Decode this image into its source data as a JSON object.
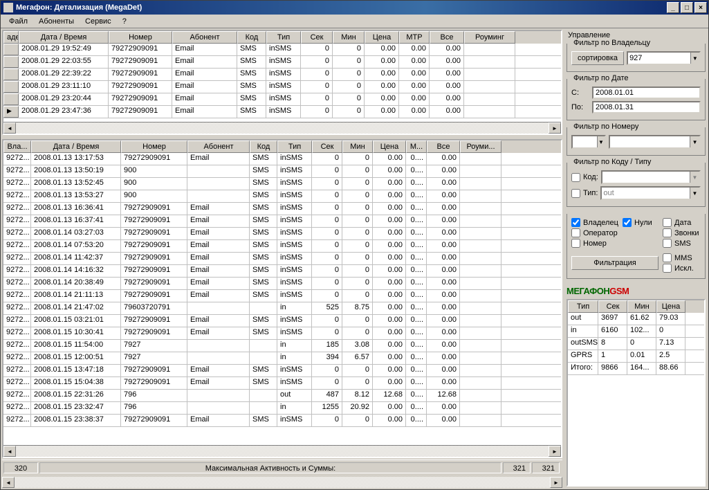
{
  "window": {
    "title": "Мегафон: Детализация (MegaDet)"
  },
  "menu": [
    "Файл",
    "Абоненты",
    "Сервис",
    "?"
  ],
  "grid1": {
    "headers": [
      "аде…",
      "Дата / Время",
      "Номер",
      "Абонент",
      "Код",
      "Тип",
      "Сек",
      "Мин",
      "Цена",
      "МТР",
      "Все",
      "Роуминг"
    ],
    "rows": [
      {
        "mark": "",
        "dt": "2008.01.29 19:52:49",
        "num": "79272909091",
        "ab": "Email",
        "kod": "SMS",
        "tip": "inSMS",
        "sek": "0",
        "min": "0",
        "price": "0.00",
        "mtr": "0.00",
        "all": "0.00",
        "roam": ""
      },
      {
        "mark": "",
        "dt": "2008.01.29 22:03:55",
        "num": "79272909091",
        "ab": "Email",
        "kod": "SMS",
        "tip": "inSMS",
        "sek": "0",
        "min": "0",
        "price": "0.00",
        "mtr": "0.00",
        "all": "0.00",
        "roam": ""
      },
      {
        "mark": "",
        "dt": "2008.01.29 22:39:22",
        "num": "79272909091",
        "ab": "Email",
        "kod": "SMS",
        "tip": "inSMS",
        "sek": "0",
        "min": "0",
        "price": "0.00",
        "mtr": "0.00",
        "all": "0.00",
        "roam": ""
      },
      {
        "mark": "",
        "dt": "2008.01.29 23:11:10",
        "num": "79272909091",
        "ab": "Email",
        "kod": "SMS",
        "tip": "inSMS",
        "sek": "0",
        "min": "0",
        "price": "0.00",
        "mtr": "0.00",
        "all": "0.00",
        "roam": ""
      },
      {
        "mark": "",
        "dt": "2008.01.29 23:20:44",
        "num": "79272909091",
        "ab": "Email",
        "kod": "SMS",
        "tip": "inSMS",
        "sek": "0",
        "min": "0",
        "price": "0.00",
        "mtr": "0.00",
        "all": "0.00",
        "roam": ""
      },
      {
        "mark": "cur",
        "dt": "2008.01.29 23:47:36",
        "num": "79272909091",
        "ab": "Email",
        "kod": "SMS",
        "tip": "inSMS",
        "sek": "0",
        "min": "0",
        "price": "0.00",
        "mtr": "0.00",
        "all": "0.00",
        "roam": ""
      }
    ]
  },
  "grid2": {
    "headers": [
      "Вла...",
      "Дата / Время",
      "Номер",
      "Абонент",
      "Код",
      "Тип",
      "Сек",
      "Мин",
      "Цена",
      "М...",
      "Все",
      "Роуми..."
    ],
    "rows": [
      {
        "own": "9272...",
        "dt": "2008.01.13 13:17:53",
        "num": "79272909091",
        "ab": "Email",
        "kod": "SMS",
        "tip": "inSMS",
        "sek": "0",
        "min": "0",
        "price": "0.00",
        "mtr": "0....",
        "all": "0.00",
        "roam": ""
      },
      {
        "own": "9272...",
        "dt": "2008.01.13 13:50:19",
        "num": "900",
        "ab": "",
        "kod": "SMS",
        "tip": "inSMS",
        "sek": "0",
        "min": "0",
        "price": "0.00",
        "mtr": "0....",
        "all": "0.00",
        "roam": ""
      },
      {
        "own": "9272...",
        "dt": "2008.01.13 13:52:45",
        "num": "900",
        "ab": "",
        "kod": "SMS",
        "tip": "inSMS",
        "sek": "0",
        "min": "0",
        "price": "0.00",
        "mtr": "0....",
        "all": "0.00",
        "roam": ""
      },
      {
        "own": "9272...",
        "dt": "2008.01.13 13:53:27",
        "num": "900",
        "ab": "",
        "kod": "SMS",
        "tip": "inSMS",
        "sek": "0",
        "min": "0",
        "price": "0.00",
        "mtr": "0....",
        "all": "0.00",
        "roam": ""
      },
      {
        "own": "9272...",
        "dt": "2008.01.13 16:36:41",
        "num": "79272909091",
        "ab": "Email",
        "kod": "SMS",
        "tip": "inSMS",
        "sek": "0",
        "min": "0",
        "price": "0.00",
        "mtr": "0....",
        "all": "0.00",
        "roam": ""
      },
      {
        "own": "9272...",
        "dt": "2008.01.13 16:37:41",
        "num": "79272909091",
        "ab": "Email",
        "kod": "SMS",
        "tip": "inSMS",
        "sek": "0",
        "min": "0",
        "price": "0.00",
        "mtr": "0....",
        "all": "0.00",
        "roam": ""
      },
      {
        "own": "9272...",
        "dt": "2008.01.14 03:27:03",
        "num": "79272909091",
        "ab": "Email",
        "kod": "SMS",
        "tip": "inSMS",
        "sek": "0",
        "min": "0",
        "price": "0.00",
        "mtr": "0....",
        "all": "0.00",
        "roam": ""
      },
      {
        "own": "9272...",
        "dt": "2008.01.14 07:53:20",
        "num": "79272909091",
        "ab": "Email",
        "kod": "SMS",
        "tip": "inSMS",
        "sek": "0",
        "min": "0",
        "price": "0.00",
        "mtr": "0....",
        "all": "0.00",
        "roam": ""
      },
      {
        "own": "9272...",
        "dt": "2008.01.14 11:42:37",
        "num": "79272909091",
        "ab": "Email",
        "kod": "SMS",
        "tip": "inSMS",
        "sek": "0",
        "min": "0",
        "price": "0.00",
        "mtr": "0....",
        "all": "0.00",
        "roam": ""
      },
      {
        "own": "9272...",
        "dt": "2008.01.14 14:16:32",
        "num": "79272909091",
        "ab": "Email",
        "kod": "SMS",
        "tip": "inSMS",
        "sek": "0",
        "min": "0",
        "price": "0.00",
        "mtr": "0....",
        "all": "0.00",
        "roam": ""
      },
      {
        "own": "9272...",
        "dt": "2008.01.14 20:38:49",
        "num": "79272909091",
        "ab": "Email",
        "kod": "SMS",
        "tip": "inSMS",
        "sek": "0",
        "min": "0",
        "price": "0.00",
        "mtr": "0....",
        "all": "0.00",
        "roam": ""
      },
      {
        "own": "9272...",
        "dt": "2008.01.14 21:11:13",
        "num": "79272909091",
        "ab": "Email",
        "kod": "SMS",
        "tip": "inSMS",
        "sek": "0",
        "min": "0",
        "price": "0.00",
        "mtr": "0....",
        "all": "0.00",
        "roam": ""
      },
      {
        "own": "9272...",
        "dt": "2008.01.14 21:47:02",
        "num": "79603720791",
        "ab": "",
        "kod": "",
        "tip": "in",
        "sek": "525",
        "min": "8.75",
        "price": "0.00",
        "mtr": "0....",
        "all": "0.00",
        "roam": ""
      },
      {
        "own": "9272...",
        "dt": "2008.01.15 03:21:01",
        "num": "79272909091",
        "ab": "Email",
        "kod": "SMS",
        "tip": "inSMS",
        "sek": "0",
        "min": "0",
        "price": "0.00",
        "mtr": "0....",
        "all": "0.00",
        "roam": ""
      },
      {
        "own": "9272...",
        "dt": "2008.01.15 10:30:41",
        "num": "79272909091",
        "ab": "Email",
        "kod": "SMS",
        "tip": "inSMS",
        "sek": "0",
        "min": "0",
        "price": "0.00",
        "mtr": "0....",
        "all": "0.00",
        "roam": ""
      },
      {
        "own": "9272...",
        "dt": "2008.01.15 11:54:00",
        "num": "7927",
        "ab": "",
        "kod": "",
        "tip": "in",
        "sek": "185",
        "min": "3.08",
        "price": "0.00",
        "mtr": "0....",
        "all": "0.00",
        "roam": ""
      },
      {
        "own": "9272...",
        "dt": "2008.01.15 12:00:51",
        "num": "7927",
        "ab": "",
        "kod": "",
        "tip": "in",
        "sek": "394",
        "min": "6.57",
        "price": "0.00",
        "mtr": "0....",
        "all": "0.00",
        "roam": ""
      },
      {
        "own": "9272...",
        "dt": "2008.01.15 13:47:18",
        "num": "79272909091",
        "ab": "Email",
        "kod": "SMS",
        "tip": "inSMS",
        "sek": "0",
        "min": "0",
        "price": "0.00",
        "mtr": "0....",
        "all": "0.00",
        "roam": ""
      },
      {
        "own": "9272...",
        "dt": "2008.01.15 15:04:38",
        "num": "79272909091",
        "ab": "Email",
        "kod": "SMS",
        "tip": "inSMS",
        "sek": "0",
        "min": "0",
        "price": "0.00",
        "mtr": "0....",
        "all": "0.00",
        "roam": ""
      },
      {
        "own": "9272...",
        "dt": "2008.01.15 22:31:26",
        "num": "796",
        "ab": "",
        "kod": "",
        "tip": "out",
        "sek": "487",
        "min": "8.12",
        "price": "12.68",
        "mtr": "0....",
        "all": "12.68",
        "roam": ""
      },
      {
        "own": "9272...",
        "dt": "2008.01.15 23:32:47",
        "num": "796",
        "ab": "",
        "kod": "",
        "tip": "in",
        "sek": "1255",
        "min": "20.92",
        "price": "0.00",
        "mtr": "0....",
        "all": "0.00",
        "roam": ""
      },
      {
        "own": "9272...",
        "dt": "2008.01.15 23:38:37",
        "num": "79272909091",
        "ab": "Email",
        "kod": "SMS",
        "tip": "inSMS",
        "sek": "0",
        "min": "0",
        "price": "0.00",
        "mtr": "0....",
        "all": "0.00",
        "roam": ""
      }
    ]
  },
  "status": {
    "left": "320",
    "center": "Максимальная Активность и Суммы:",
    "right1": "321",
    "right2": "321"
  },
  "panel": {
    "heading": "Управление",
    "ownerFilter": {
      "title": "Фильтр по Владельцу",
      "sortBtn": "сортировка",
      "value": "927"
    },
    "dateFilter": {
      "title": "Фильтр по Дате",
      "fromLbl": "С:",
      "from": "2008.01.01",
      "toLbl": "По:",
      "to": "2008.01.31"
    },
    "numFilter": {
      "title": "Фильтр по Номеру"
    },
    "codeFilter": {
      "title": "Фильтр по Коду / Типу",
      "codeLbl": "Код:",
      "typeLbl": "Тип:",
      "typeVal": "out"
    },
    "checks": {
      "owner": "Владелец",
      "nulls": "Нули",
      "date": "Дата",
      "operator": "Оператор",
      "calls": "Звонки",
      "number": "Номер",
      "sms": "SMS",
      "mms": "MMS",
      "excl": "Искл."
    },
    "filterBtn": "Фильтрация",
    "logo": {
      "m": "МЕГАФОН",
      "g": "GSM"
    },
    "summary": {
      "headers": [
        "Тип",
        "Сек",
        "Мин",
        "Цена"
      ],
      "rows": [
        {
          "t": "out",
          "s": "3697",
          "m": "61.62",
          "p": "79.03"
        },
        {
          "t": "in",
          "s": "6160",
          "m": "102...",
          "p": "0"
        },
        {
          "t": "outSMS",
          "s": "8",
          "m": "0",
          "p": "7.13"
        },
        {
          "t": "GPRS",
          "s": "1",
          "m": "0.01",
          "p": "2.5"
        },
        {
          "t": "Итого:",
          "s": "9866",
          "m": "164...",
          "p": "88.66"
        }
      ]
    }
  }
}
